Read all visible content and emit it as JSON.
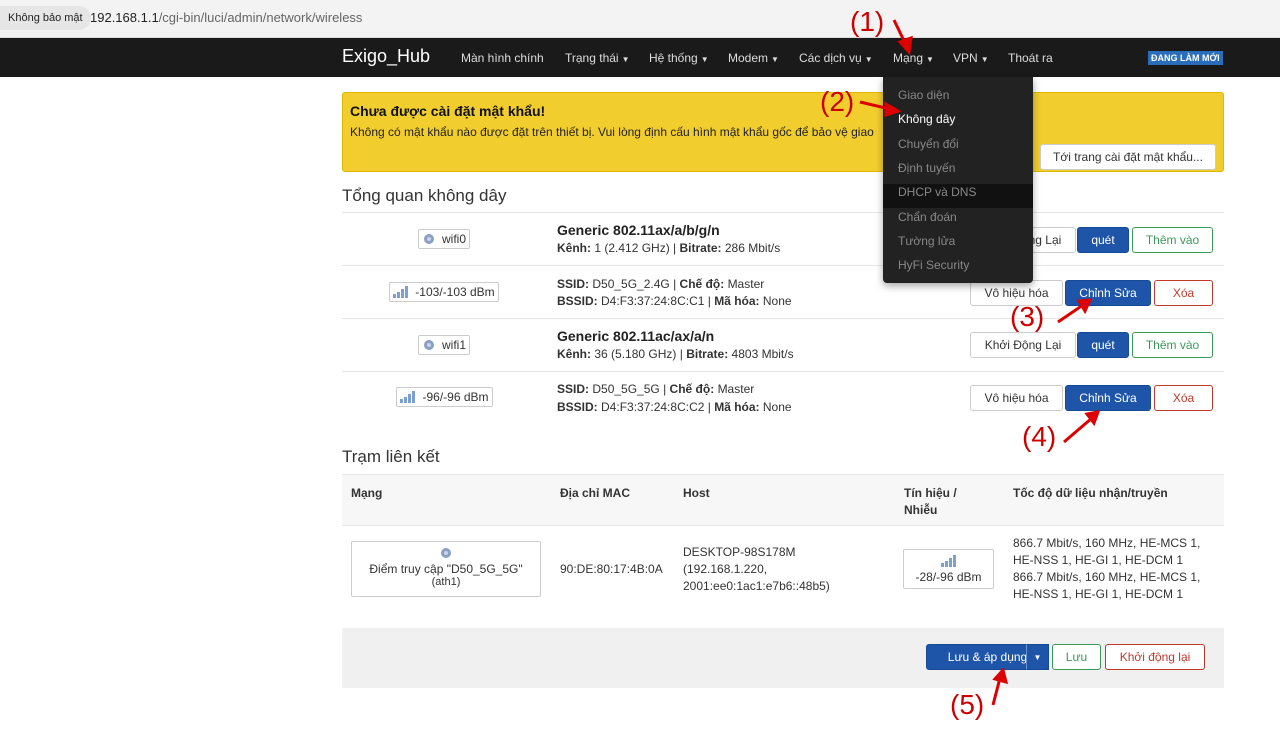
{
  "browser": {
    "security_chip": "Không bảo mật",
    "url_host": "192.168.1.1",
    "url_path": "/cgi-bin/luci/admin/network/wireless"
  },
  "nav": {
    "brand": "Exigo_Hub",
    "items": [
      "Màn hình chính",
      "Trạng thái",
      "Hệ thống",
      "Modem",
      "Các dịch vụ",
      "Mạng",
      "VPN",
      "Thoát ra"
    ],
    "refresh_badge": "ĐANG LÀM MỚI"
  },
  "dropdown": {
    "items": [
      "Giao diện",
      "Không dây",
      "Chuyển đổi",
      "Định tuyến",
      "DHCP và DNS",
      "Chẩn đoán",
      "Tường lửa",
      "HyFi Security"
    ],
    "active_index": 1
  },
  "warning": {
    "title": "Chưa được cài đặt mật khẩu!",
    "text": "Không có mật khẩu nào được đặt trên thiết bị. Vui lòng định cấu hình mật khẩu gốc để bảo vệ giao",
    "button": "Tới trang cài đặt mật khẩu..."
  },
  "overview": {
    "title": "Tổng quan không dây",
    "devices": [
      {
        "badge": "wifi0",
        "title": "Generic 802.11ax/a/b/g/n",
        "channel_label": "Kênh:",
        "channel": "1 (2.412 GHz)",
        "bitrate_label": "Bitrate:",
        "bitrate": "286 Mbit/s",
        "btn_restart": "Khởi Động Lại",
        "btn_scan": "quét",
        "btn_add": "Thêm vào"
      },
      {
        "signal": "-103/-103 dBm",
        "ssid_label": "SSID:",
        "ssid": "D50_5G_2.4G",
        "mode_label": "Chế độ:",
        "mode": "Master",
        "bssid_label": "BSSID:",
        "bssid": "D4:F3:37:24:8C:C1",
        "enc_label": "Mã hóa:",
        "enc": "None",
        "btn_disable": "Vô hiệu hóa",
        "btn_edit": "Chỉnh Sửa",
        "btn_delete": "Xóa"
      },
      {
        "badge": "wifi1",
        "title": "Generic 802.11ac/ax/a/n",
        "channel_label": "Kênh:",
        "channel": "36 (5.180 GHz)",
        "bitrate_label": "Bitrate:",
        "bitrate": "4803 Mbit/s",
        "btn_restart": "Khởi Động Lại",
        "btn_scan": "quét",
        "btn_add": "Thêm vào"
      },
      {
        "signal": "-96/-96 dBm",
        "ssid_label": "SSID:",
        "ssid": "D50_5G_5G",
        "mode_label": "Chế độ:",
        "mode": "Master",
        "bssid_label": "BSSID:",
        "bssid": "D4:F3:37:24:8C:C2",
        "enc_label": "Mã hóa:",
        "enc": "None",
        "btn_disable": "Vô hiệu hóa",
        "btn_edit": "Chỉnh Sửa",
        "btn_delete": "Xóa"
      }
    ]
  },
  "stations": {
    "title": "Trạm liên kết",
    "headers": {
      "network": "Mạng",
      "mac": "Địa chỉ MAC",
      "host": "Host",
      "signal_line1": "Tín hiệu /",
      "signal_line2": "Nhiễu",
      "rate": "Tốc độ dữ liệu nhận/truyền"
    },
    "row": {
      "ap_name": "Điểm truy cập \"D50_5G_5G\"",
      "ap_iface": "(ath1)",
      "mac": "90:DE:80:17:4B:0A",
      "host_line1": "DESKTOP-98S178M",
      "host_line2": "(192.168.1.220,",
      "host_line3": "2001:ee0:1ac1:e7b6::48b5)",
      "signal": "-28/-96 dBm",
      "rate_lines": [
        "866.7 Mbit/s, 160 MHz, HE-MCS 1,",
        "HE-NSS 1, HE-GI 1, HE-DCM 1",
        "866.7 Mbit/s, 160 MHz, HE-MCS 1,",
        "HE-NSS 1, HE-GI 1, HE-DCM 1"
      ]
    }
  },
  "footer": {
    "save_apply": "Lưu & áp dụng",
    "save": "Lưu",
    "reset": "Khởi động lại"
  },
  "annotations": [
    "(1)",
    "(2)",
    "(3)",
    "(4)",
    "(5)"
  ],
  "colors": {
    "accent": "#1e55a8",
    "warning": "#f2cd2e",
    "annotation": "#cc0000",
    "success": "#3a9a5a",
    "danger": "#c0392b"
  }
}
